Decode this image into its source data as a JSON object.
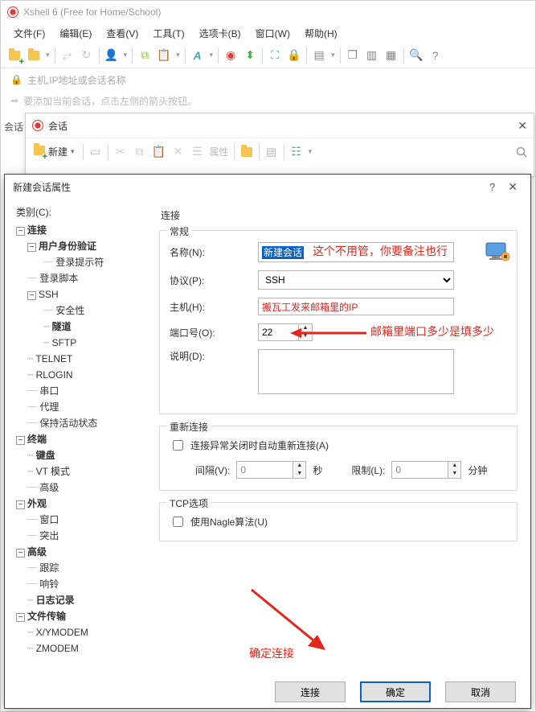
{
  "app": {
    "title": "Xshell 6 (Free for Home/School)"
  },
  "menu": {
    "file": "文件(F)",
    "edit": "编辑(E)",
    "view": "查看(V)",
    "tools": "工具(T)",
    "tabs": "选项卡(B)",
    "window": "窗口(W)",
    "help": "帮助(H)"
  },
  "address": {
    "placeholder": "主机,IP地址或会话名称"
  },
  "hint": {
    "text": "要添加当前会话，点击左侧的箭头按钮。"
  },
  "sessions_tab_label": "会话",
  "sessions_dialog": {
    "title": "会话",
    "new_btn": "新建",
    "props_label": "属性"
  },
  "props": {
    "title": "新建会话属性",
    "category_label": "类别(C):",
    "tree": {
      "connection": "连接",
      "auth": "用户身份验证",
      "login_prompt": "登录提示符",
      "login_script": "登录脚本",
      "ssh": "SSH",
      "security": "安全性",
      "tunnel": "隧道",
      "sftp": "SFTP",
      "telnet": "TELNET",
      "rlogin": "RLOGIN",
      "serial": "串口",
      "proxy": "代理",
      "keepalive": "保持活动状态",
      "terminal": "终端",
      "keyboard": "键盘",
      "vtmode": "VT 模式",
      "advanced_t": "高级",
      "appearance": "外观",
      "window": "窗口",
      "highlight": "突出",
      "advanced": "高级",
      "trace": "跟踪",
      "bell": "响铃",
      "logging": "日志记录",
      "filetransfer": "文件传输",
      "xymodem": "X/YMODEM",
      "zmodem": "ZMODEM"
    },
    "panel_title": "连接",
    "groups": {
      "general": "常规",
      "reconnect": "重新连接",
      "tcp": "TCP选项"
    },
    "fields": {
      "name_label": "名称(N):",
      "name_value": "新建会话",
      "protocol_label": "协议(P):",
      "protocol_value": "SSH",
      "host_label": "主机(H):",
      "host_value": "搬瓦工发来邮箱里的IP",
      "port_label": "端口号(O):",
      "port_value": "22",
      "desc_label": "说明(D):",
      "desc_value": ""
    },
    "reconnect": {
      "auto_label": "连接异常关闭时自动重新连接(A)",
      "interval_label": "间隔(V):",
      "interval_value": "0",
      "seconds": "秒",
      "limit_label": "限制(L):",
      "limit_value": "0",
      "minutes": "分钟"
    },
    "tcp": {
      "nagle_label": "使用Nagle算法(U)"
    },
    "buttons": {
      "connect": "连接",
      "ok": "确定",
      "cancel": "取消"
    }
  },
  "annotations": {
    "name_note": "这个不用管，你要备注也行",
    "port_note": "邮箱里端口多少是填多少",
    "connect_note": "确定连接"
  }
}
